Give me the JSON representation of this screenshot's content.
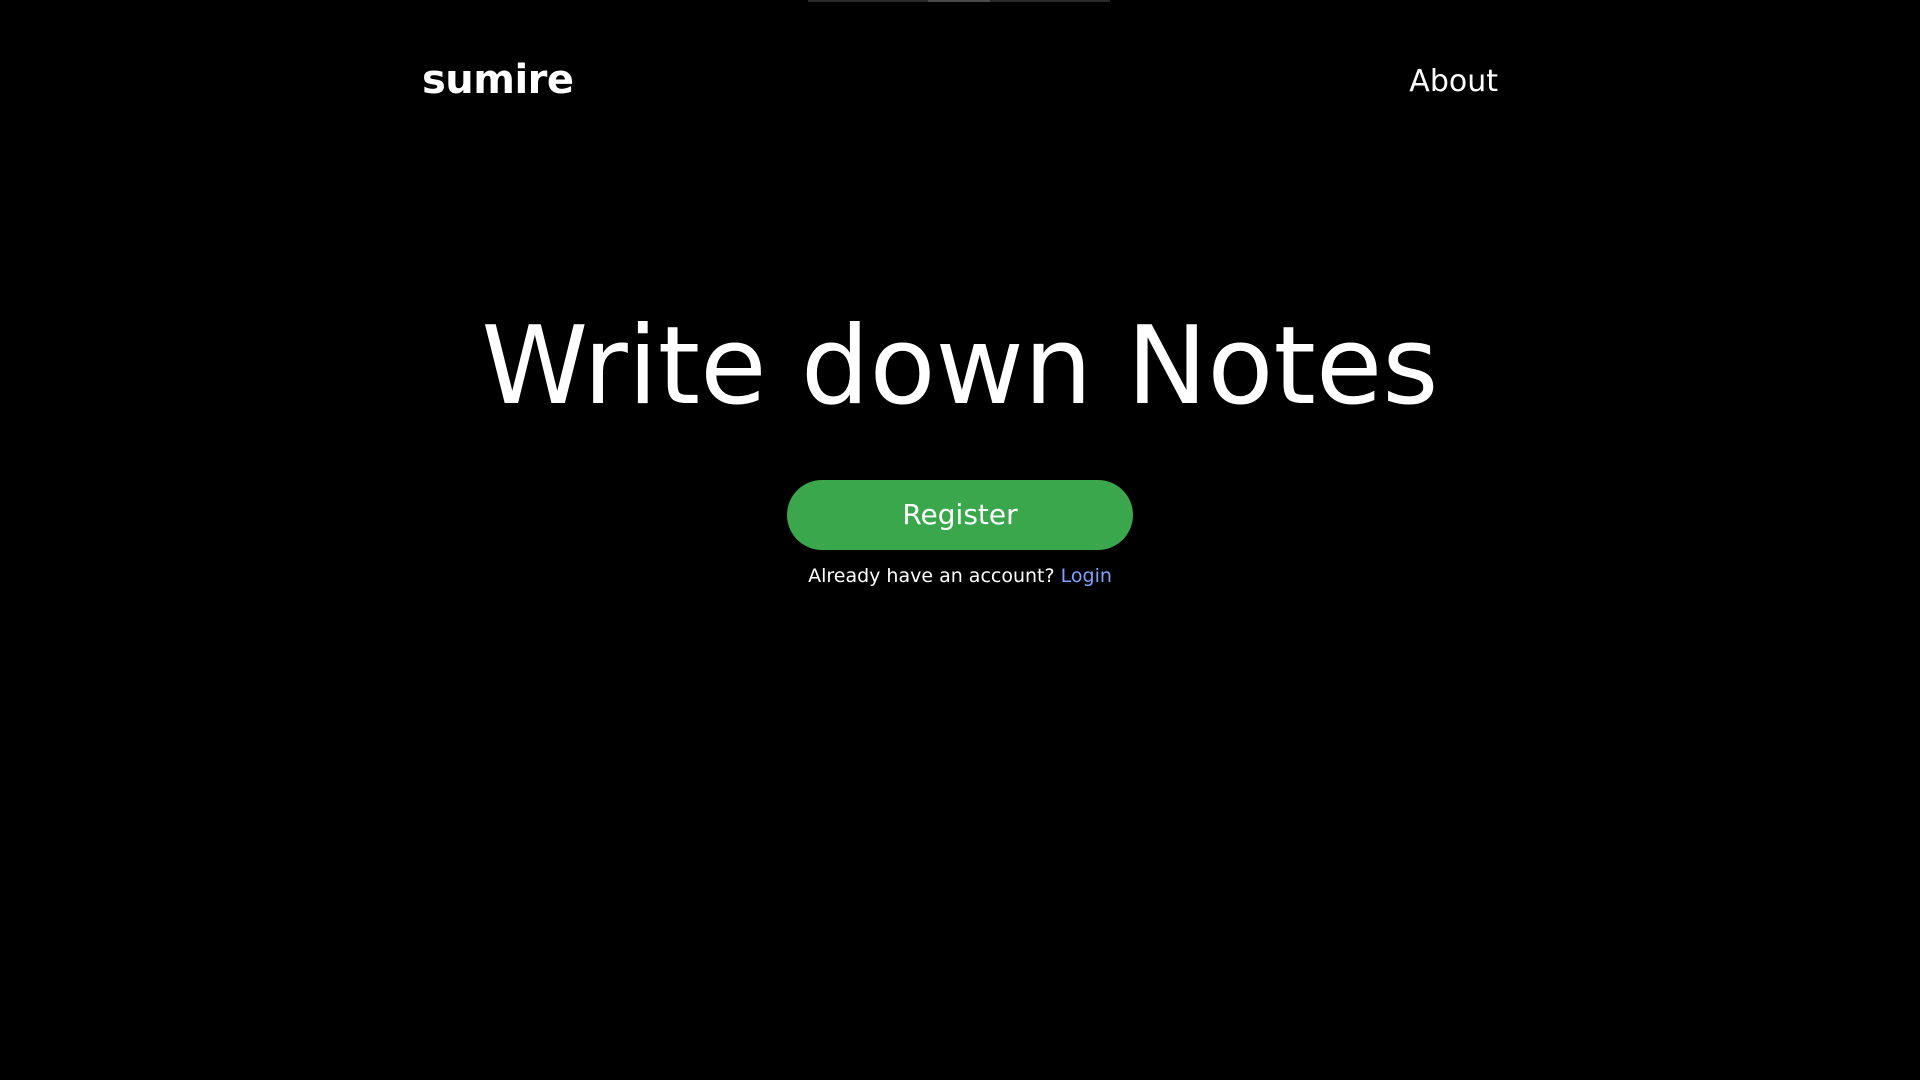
{
  "header": {
    "brand": "sumire",
    "nav": {
      "about_label": "About"
    }
  },
  "hero": {
    "title": "Write down Notes",
    "register_label": "Register",
    "account_prompt": "Already have an account?",
    "login_label": "Login"
  },
  "colors": {
    "background": "#000000",
    "text": "#ffffff",
    "accent_button": "#3aa74c",
    "link": "#7da2ff"
  }
}
